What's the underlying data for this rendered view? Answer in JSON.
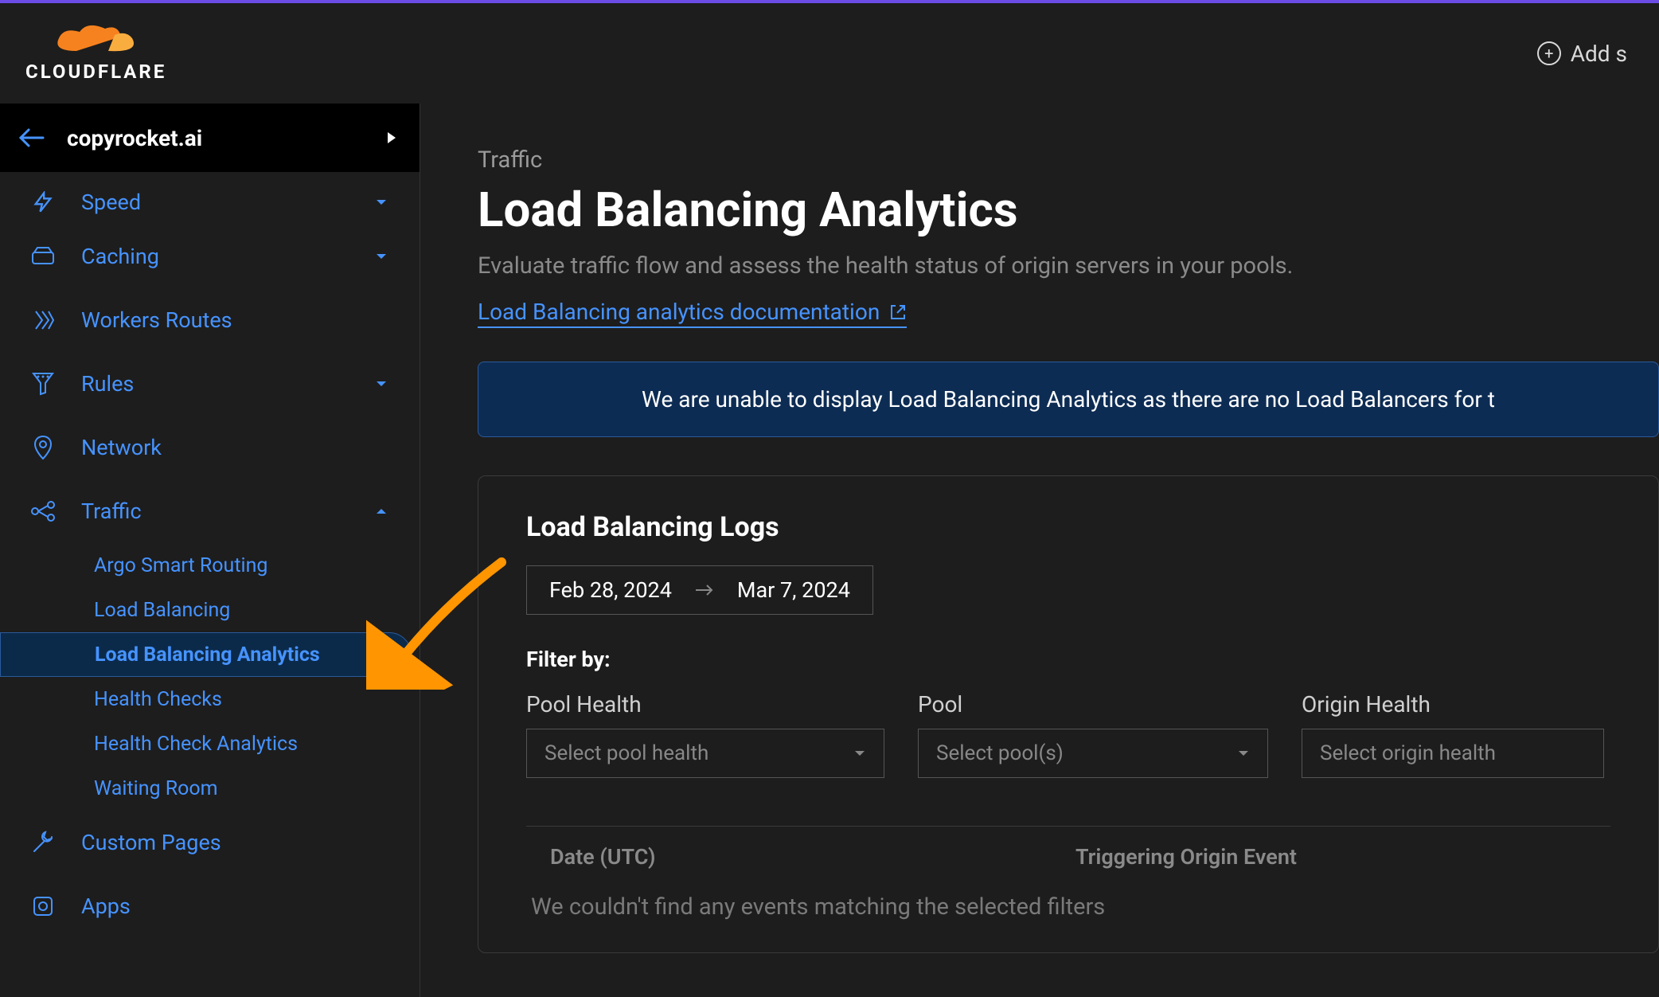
{
  "brand": "CLOUDFLARE",
  "header": {
    "add_label": "Add s"
  },
  "domain": {
    "name": "copyrocket.ai"
  },
  "sidebar": {
    "items": [
      {
        "label": "Speed",
        "icon": "bolt-icon",
        "expandable": true
      },
      {
        "label": "Caching",
        "icon": "drive-icon",
        "expandable": true
      },
      {
        "label": "Workers Routes",
        "icon": "workers-icon",
        "expandable": false
      },
      {
        "label": "Rules",
        "icon": "funnel-icon",
        "expandable": true
      },
      {
        "label": "Network",
        "icon": "pin-icon",
        "expandable": false
      },
      {
        "label": "Traffic",
        "icon": "nodes-icon",
        "expandable": true,
        "expanded": true
      },
      {
        "label": "Custom Pages",
        "icon": "wrench-icon",
        "expandable": false
      },
      {
        "label": "Apps",
        "icon": "apps-icon",
        "expandable": false
      }
    ],
    "traffic_sub": [
      {
        "label": "Argo Smart Routing",
        "active": false
      },
      {
        "label": "Load Balancing",
        "active": false
      },
      {
        "label": "Load Balancing Analytics",
        "active": true
      },
      {
        "label": "Health Checks",
        "active": false
      },
      {
        "label": "Health Check Analytics",
        "active": false
      },
      {
        "label": "Waiting Room",
        "active": false
      }
    ]
  },
  "page": {
    "breadcrumb": "Traffic",
    "title": "Load Balancing Analytics",
    "subtitle": "Evaluate traffic flow and assess the health status of origin servers in your pools.",
    "doc_link": "Load Balancing analytics documentation",
    "banner": "We are unable to display Load Balancing Analytics as there are no Load Balancers for t"
  },
  "logs": {
    "heading": "Load Balancing Logs",
    "date_from": "Feb 28, 2024",
    "date_to": "Mar 7, 2024",
    "filter_by": "Filter by:",
    "filters": {
      "pool_health": {
        "label": "Pool Health",
        "placeholder": "Select pool health"
      },
      "pool": {
        "label": "Pool",
        "placeholder": "Select pool(s)"
      },
      "origin_health": {
        "label": "Origin Health",
        "placeholder": "Select origin health"
      }
    },
    "table": {
      "col_date": "Date (UTC)",
      "col_event": "Triggering Origin Event",
      "empty": "We couldn't find any events matching the selected filters"
    }
  }
}
